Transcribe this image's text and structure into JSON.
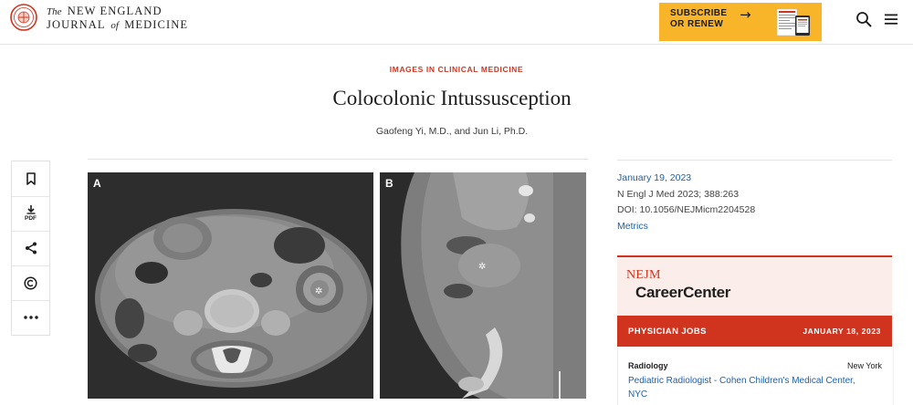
{
  "header": {
    "brand_the": "The",
    "brand_line1": "NEW ENGLAND",
    "brand_line2a": "JOURNAL",
    "brand_of": "of",
    "brand_line2b": "MEDICINE",
    "promo_line1": "SUBSCRIBE",
    "promo_line2": "OR RENEW",
    "promo_color": "#f9b52a"
  },
  "article": {
    "kicker": "IMAGES IN CLINICAL MEDICINE",
    "title": "Colocolonic Intussusception",
    "authors": "Gaofeng Yi, M.D., and Jun Li, Ph.D.",
    "panel_a_label": "A",
    "panel_b_label": "B",
    "accent_color": "#d0341f"
  },
  "tools": [
    "bookmark-icon",
    "pdf-download-icon",
    "share-icon",
    "copyright-icon",
    "more-icon"
  ],
  "tools_pdf_label": "PDF",
  "meta": {
    "date": "January 19, 2023",
    "citation": "N Engl J Med 2023; 388:263",
    "doi": "DOI: 10.1056/NEJMicm2204528",
    "metrics": "Metrics",
    "link_color": "#1f5fa9"
  },
  "career": {
    "logo_nejm": "NEJM",
    "logo_cc": "CareerCenter",
    "bar_title": "PHYSICIAN JOBS",
    "bar_date": "JANUARY 18, 2023",
    "job_specialty": "Radiology",
    "job_location": "New York",
    "job_title": "Pediatric Radiologist - Cohen Children's Medical Center, NYC"
  }
}
